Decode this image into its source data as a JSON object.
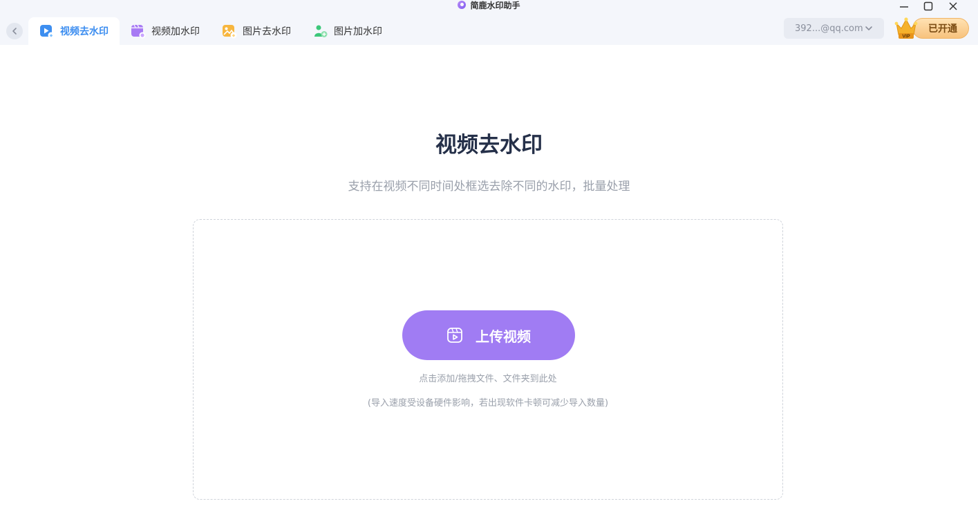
{
  "app": {
    "title": "简鹿水印助手"
  },
  "tabs": [
    {
      "label": "视频去水印",
      "active": true
    },
    {
      "label": "视频加水印",
      "active": false
    },
    {
      "label": "图片去水印",
      "active": false
    },
    {
      "label": "图片加水印",
      "active": false
    }
  ],
  "account": {
    "email": "392...@qq.com"
  },
  "vip": {
    "label": "已开通",
    "badge": "VIP"
  },
  "main": {
    "title": "视频去水印",
    "subtitle": "支持在视频不同时间处框选去除不同的水印，批量处理",
    "upload_label": "上传视频",
    "hint_primary": "点击添加/拖拽文件、文件夹到此处",
    "hint_secondary": "(导入速度受设备硬件影响，若出现软件卡顿可减少导入数量)"
  },
  "colors": {
    "accent": "#3d8ef0",
    "upload_button": "#a07cf3",
    "vip_gold": "#f7c27d"
  },
  "icons": {
    "back": "chevron-left-icon",
    "tab_video_remove": "video-erase-icon",
    "tab_video_add": "video-add-icon",
    "tab_image_remove": "image-erase-icon",
    "tab_image_add": "image-add-icon",
    "upload": "video-upload-icon",
    "vip": "crown-icon"
  }
}
